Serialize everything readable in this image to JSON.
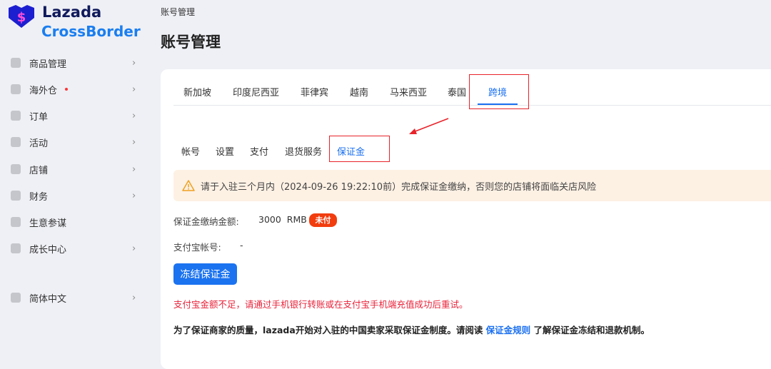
{
  "logo": {
    "line1": "Lazada",
    "line2": "CrossBorder"
  },
  "sidebar": {
    "items": [
      {
        "label": "商品管理",
        "icon": "box-icon"
      },
      {
        "label": "海外仓",
        "icon": "warehouse-icon",
        "dot": true
      },
      {
        "label": "订单",
        "icon": "order-icon"
      },
      {
        "label": "活动",
        "icon": "promotion-icon"
      },
      {
        "label": "店铺",
        "icon": "store-icon"
      },
      {
        "label": "财务",
        "icon": "finance-icon"
      },
      {
        "label": "生意参谋",
        "icon": "analytics-icon",
        "nochev": true
      },
      {
        "label": "成长中心",
        "icon": "growth-icon"
      },
      {
        "label": "简体中文",
        "icon": "language-icon"
      }
    ]
  },
  "breadcrumb": "账号管理",
  "page_title": "账号管理",
  "country_tabs": [
    "新加坡",
    "印度尼西亚",
    "菲律宾",
    "越南",
    "马来西亚",
    "泰国",
    "跨境"
  ],
  "sub_tabs": [
    "帐号",
    "设置",
    "支付",
    "退货服务",
    "保证金"
  ],
  "alert": "请于入驻三个月内（2024-09-26 19:22:10前）完成保证金缴纳，否则您的店铺将面临关店风险",
  "deposit": {
    "amount_label": "保证金缴纳金额:",
    "amount": "3000  RMB",
    "status": "未付",
    "alipay_label": "支付宝帐号:",
    "alipay_value": "-"
  },
  "freeze_button": "冻结保证金",
  "error_text": "支付宝金额不足，请通过手机银行转账或在支付宝手机端充值成功后重试。",
  "info": {
    "before": "为了保证商家的质量，lazada开始对入驻的中国卖家采取保证金制度。请阅读 ",
    "link": "保证金规则",
    "after": " 了解保证金冻结和退款机制。"
  },
  "colors": {
    "accent": "#1b73f0",
    "danger": "#e8232a",
    "badge": "#f23d0f"
  }
}
